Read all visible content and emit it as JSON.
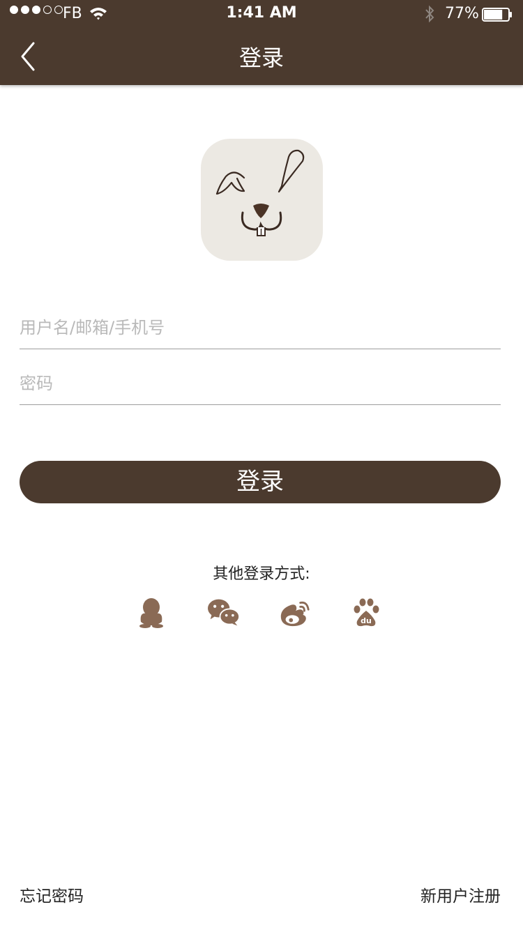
{
  "status_bar": {
    "carrier": "FB",
    "time": "1:41 AM",
    "battery_percent": "77%",
    "battery_level": 0.77,
    "signal_bars_filled": 3,
    "signal_bars_total": 5
  },
  "nav": {
    "title": "登录",
    "back_icon": "chevron-left-icon"
  },
  "logo": {
    "icon": "rabbit-face-logo"
  },
  "form": {
    "username_placeholder": "用户名/邮箱/手机号",
    "username_value": "",
    "password_placeholder": "密码",
    "password_value": ""
  },
  "login_button": {
    "label": "登录"
  },
  "other_login": {
    "label": "其他登录方式:",
    "methods": [
      "qq-icon",
      "wechat-icon",
      "weibo-icon",
      "baidu-icon"
    ]
  },
  "footer": {
    "forgot_password": "忘记密码",
    "register": "新用户注册"
  },
  "colors": {
    "brand": "#4b3a2e",
    "social_icon": "#8a6a55",
    "logo_bg": "#ece9e3",
    "divider": "#9d9d9d"
  }
}
